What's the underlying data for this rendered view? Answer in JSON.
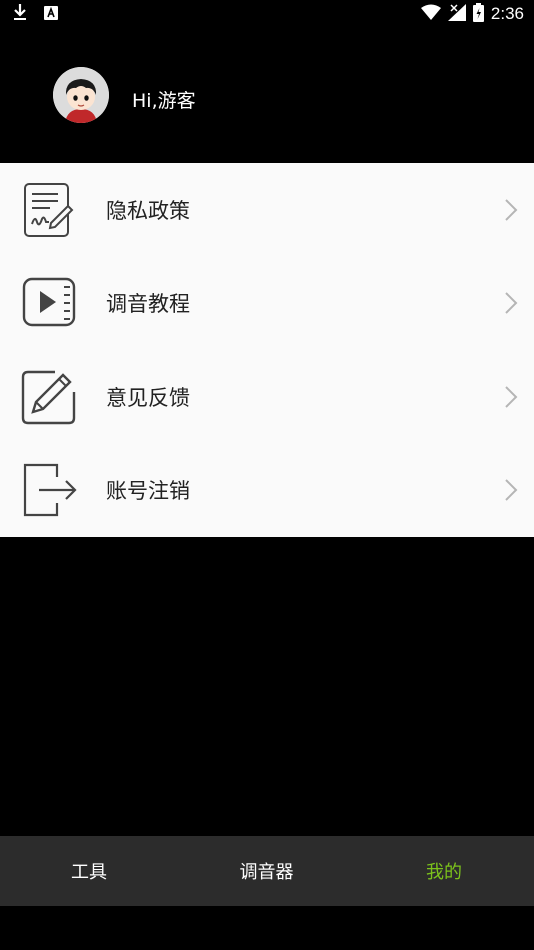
{
  "status_bar": {
    "time": "2:36",
    "icons": [
      "download-icon",
      "a-notification-icon",
      "wifi-icon",
      "signal-icon",
      "battery-icon"
    ]
  },
  "profile": {
    "greeting": "Hi,游客",
    "avatar_icon": "user-avatar"
  },
  "menu": {
    "items": [
      {
        "label": "隐私政策",
        "icon": "document-sign-icon"
      },
      {
        "label": "调音教程",
        "icon": "video-play-icon"
      },
      {
        "label": "意见反馈",
        "icon": "edit-pencil-icon"
      },
      {
        "label": "账号注销",
        "icon": "logout-icon"
      }
    ]
  },
  "tab_bar": {
    "tabs": [
      {
        "label": "工具",
        "active": false
      },
      {
        "label": "调音器",
        "active": false
      },
      {
        "label": "我的",
        "active": true
      }
    ],
    "active_color": "#7cc21c"
  }
}
